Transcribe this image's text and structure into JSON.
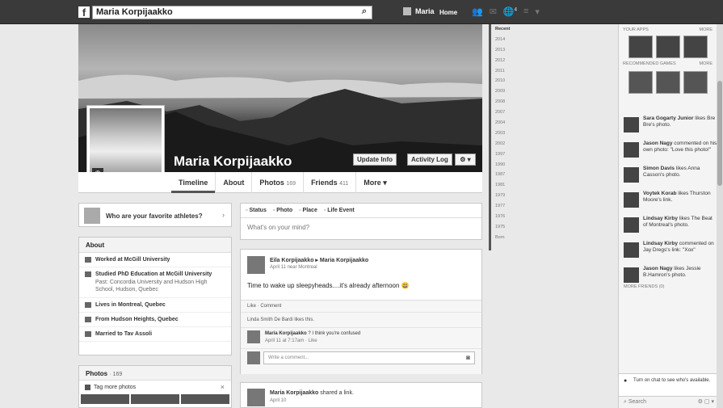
{
  "topbar": {
    "search_value": "Maria Korpijaakko",
    "user_name": "Maria",
    "home_label": "Home",
    "notification_count": "4"
  },
  "profile": {
    "name": "Maria Korpijaakko",
    "update_info": "Update Info",
    "activity_log": "Activity Log"
  },
  "tabs": [
    {
      "label": "Timeline",
      "count": ""
    },
    {
      "label": "About",
      "count": ""
    },
    {
      "label": "Photos",
      "count": "169"
    },
    {
      "label": "Friends",
      "count": "411"
    },
    {
      "label": "More ▾",
      "count": ""
    }
  ],
  "athletes": {
    "text": "Who are your favorite athletes?"
  },
  "about": {
    "title": "About",
    "rows": [
      {
        "text": "Worked at McGill University",
        "sub": ""
      },
      {
        "text": "Studied PhD Education at McGill University",
        "sub": "Past: Concordia University and Hudson High School, Hudson, Quebec"
      },
      {
        "text": "Lives in Montreal, Quebec",
        "sub": ""
      },
      {
        "text": "From Hudson Heights, Quebec",
        "sub": ""
      },
      {
        "text": "Married to Tav Assoli",
        "sub": ""
      }
    ]
  },
  "photos": {
    "title": "Photos",
    "count": "· 169",
    "tag": "Tag more photos"
  },
  "composer": {
    "actions": [
      "Status",
      "Photo",
      "Place",
      "Life Event"
    ],
    "placeholder": "What's on your mind?"
  },
  "post1": {
    "who": "Eila Korpijaakko ▸ Maria Korpijaakko",
    "when": "April 11 near Montreal",
    "body": "Time to wake up sleepyheads....it's already afternoon 😃",
    "actions": "Like · Comment",
    "likes": "Linda Smith De Bardi likes this.",
    "comment_author": "Maria Korpijaakko",
    "comment_text": " ? I think you're confused",
    "comment_meta": "April 11 at 7:17am · Like",
    "write_placeholder": "Write a comment..."
  },
  "post2": {
    "author": "Maria Korpijaakko",
    "action": " shared a link.",
    "when": "April 10"
  },
  "years": [
    "Recent",
    "2014",
    "2013",
    "2012",
    "2011",
    "2010",
    "2009",
    "2008",
    "2007",
    "2004",
    "2003",
    "2002",
    "1997",
    "1990",
    "1987",
    "1981",
    "1979",
    "1977",
    "1976",
    "1975",
    "Born"
  ],
  "right": {
    "your_apps": "YOUR APPS",
    "more1": "MORE",
    "recommended": "RECOMMENDED GAMES",
    "more2": "MORE",
    "ticker": [
      {
        "name": "Sara Gogarty Junior",
        "text": " likes Bre Bre's photo."
      },
      {
        "name": "Jason Nagy",
        "text": " commented on his own photo: \"Love this photo!\""
      },
      {
        "name": "Simon Davis",
        "text": " likes Anna Casson's photo."
      },
      {
        "name": "Voytek Korab",
        "text": " likes Thurston Moore's link."
      },
      {
        "name": "Lindsay Kirby",
        "text": " likes The Beat of Montreal's photo."
      },
      {
        "name": "Lindsay Kirby",
        "text": " commented on Jay Dregs's link: \"Xox\""
      },
      {
        "name": "Jason Nagy",
        "text": " likes Jessie B.Hamron's photo."
      }
    ],
    "more_friends": "MORE FRIENDS (0)",
    "chat_text": "Turn on chat to see who's available.",
    "chat_search": "Search"
  }
}
